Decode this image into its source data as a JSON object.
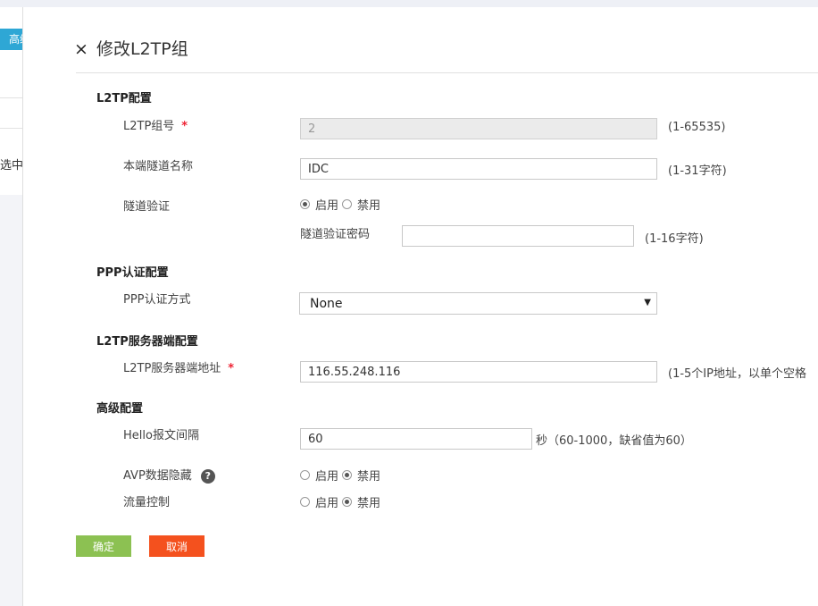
{
  "left_nav": {
    "tab_label": "高级",
    "selected_text": "选中"
  },
  "header": {
    "close_icon": "×",
    "title": "修改L2TP组"
  },
  "sections": {
    "l2tp": "L2TP配置",
    "ppp": "PPP认证配置",
    "server": "L2TP服务器端配置",
    "advanced": "高级配置"
  },
  "fields": {
    "group_no": {
      "label": "L2TP组号",
      "value": "2",
      "hint": "(1-65535)"
    },
    "tunnel_name": {
      "label": "本端隧道名称",
      "value": "IDC",
      "hint": "(1-31字符)"
    },
    "tunnel_auth": {
      "label": "隧道验证",
      "enable": "启用",
      "disable": "禁用",
      "selected": "enable"
    },
    "tunnel_password": {
      "label": "隧道验证密码",
      "value": "",
      "hint": "(1-16字符)"
    },
    "ppp_auth": {
      "label": "PPP认证方式",
      "value": "None"
    },
    "server_addr": {
      "label": "L2TP服务器端地址",
      "value": "116.55.248.116",
      "hint": "(1-5个IP地址，以单个空格"
    },
    "hello": {
      "label": "Hello报文间隔",
      "value": "60",
      "hint": "秒（60-1000，缺省值为60）"
    },
    "avp": {
      "label": "AVP数据隐藏",
      "enable": "启用",
      "disable": "禁用",
      "selected": "disable"
    },
    "flow": {
      "label": "流量控制",
      "enable": "启用",
      "disable": "禁用",
      "selected": "disable"
    }
  },
  "required_mark": "*",
  "help_icon": "?",
  "buttons": {
    "ok": "确定",
    "cancel": "取消"
  }
}
